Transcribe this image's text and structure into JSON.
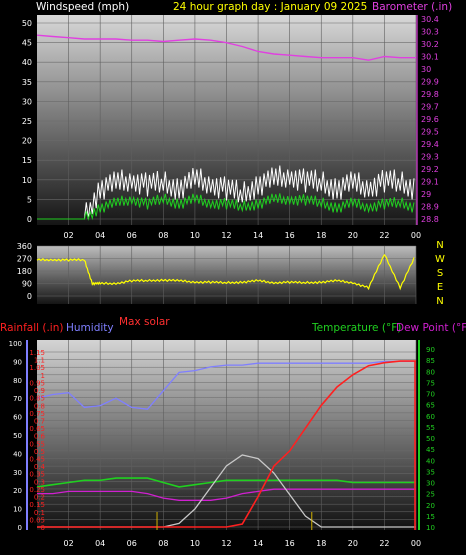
{
  "header": {
    "wind_label": "Windspeed (mph)",
    "title": "24 hour graph day : January 09 2025",
    "baro_label": "Barometer (.in)"
  },
  "labels": {
    "max_solar": "Max solar",
    "rainfall": "Rainfall (.in)",
    "humidity": "Humidity",
    "temperature": "Temperature (°F)",
    "dew_point": "Dew Point (°F)"
  },
  "colors": {
    "wind_text": "#ffffff",
    "title_text": "#ffff00",
    "baro": "#e040e0",
    "wind_avg": "#20d020",
    "wind_gust": "#ffffff",
    "direction": "#ffff00",
    "rain": "#ff2020",
    "humidity": "#7f7fff",
    "temperature": "#20d020",
    "dewpoint": "#d020d0",
    "solar": "#c8c8c8"
  },
  "x_ticks": [
    "02",
    "04",
    "06",
    "08",
    "10",
    "12",
    "14",
    "16",
    "18",
    "20",
    "22",
    "00"
  ],
  "chart_data": [
    {
      "type": "line",
      "title": "24 hour graph day : January 09 2025",
      "ylabel_left": "Windspeed (mph)",
      "ylabel_right": "Barometer (.in)",
      "ylim_left": [
        0,
        50
      ],
      "ylim_right": [
        28.8,
        30.4
      ],
      "y_ticks_left": [
        "0",
        "5",
        "10",
        "15",
        "20",
        "25",
        "30",
        "35",
        "40",
        "45",
        "50"
      ],
      "y_ticks_right": [
        "28.8",
        "28.9",
        "29",
        "29.1",
        "29.2",
        "29.3",
        "29.4",
        "29.5",
        "29.6",
        "29.7",
        "29.8",
        "29.9",
        "30",
        "30.1",
        "30.2",
        "30.3",
        "30.4"
      ],
      "x": [
        0,
        1,
        2,
        3,
        4,
        5,
        6,
        7,
        8,
        9,
        10,
        11,
        12,
        13,
        14,
        15,
        16,
        17,
        18,
        19,
        20,
        21,
        22,
        23,
        24
      ],
      "series": [
        {
          "name": "Barometer",
          "axis": "right",
          "values": [
            30.27,
            30.26,
            30.25,
            30.24,
            30.24,
            30.24,
            30.23,
            30.23,
            30.22,
            30.23,
            30.24,
            30.23,
            30.21,
            30.18,
            30.14,
            30.12,
            30.11,
            30.1,
            30.09,
            30.09,
            30.09,
            30.07,
            30.1,
            30.09,
            30.09
          ]
        },
        {
          "name": "Wind gust",
          "axis": "left",
          "values": [
            0,
            0,
            0,
            0,
            8,
            9,
            10,
            9,
            9,
            8,
            10,
            9,
            8,
            6,
            9,
            10,
            11,
            10,
            9,
            8,
            9,
            8,
            10,
            9,
            8
          ]
        },
        {
          "name": "Wind avg",
          "axis": "left",
          "values": [
            0,
            0,
            0,
            0,
            3,
            4,
            5,
            4,
            5,
            4,
            5,
            4,
            4,
            3,
            4,
            5,
            5,
            5,
            4,
            3,
            4,
            3,
            4,
            4,
            3
          ]
        }
      ]
    },
    {
      "type": "line",
      "ylabel_left": "",
      "ylim": [
        0,
        360
      ],
      "y_ticks_left": [
        "0",
        "90",
        "180",
        "270",
        "360"
      ],
      "y_ticks_right": [
        "N",
        "W",
        "S",
        "E",
        "N"
      ],
      "x": [
        0,
        1,
        2,
        3,
        3.5,
        4,
        5,
        6,
        7,
        8,
        9,
        10,
        11,
        12,
        13,
        14,
        15,
        16,
        17,
        18,
        19,
        20,
        21,
        22,
        23,
        24
      ],
      "series": [
        {
          "name": "Wind direction",
          "values": [
            260,
            260,
            260,
            260,
            90,
            90,
            90,
            110,
            110,
            115,
            110,
            100,
            100,
            95,
            100,
            110,
            95,
            100,
            95,
            100,
            110,
            95,
            60,
            300,
            60,
            300
          ]
        }
      ]
    },
    {
      "type": "line",
      "ylabel_left": "Rainfall (.in)",
      "ylabel_right": "Temperature (°F)",
      "ylim_humidity": [
        0,
        100
      ],
      "ylim_rain": [
        0,
        1.2
      ],
      "ylim_temp": [
        10,
        90
      ],
      "y_ticks_humidity": [
        "0",
        "10",
        "20",
        "30",
        "40",
        "50",
        "60",
        "70",
        "80",
        "90",
        "100"
      ],
      "y_ticks_rain": [
        "0",
        "0.05",
        "0.1",
        "0.15",
        "0.2",
        "0.25",
        "0.3",
        "0.35",
        "0.4",
        "0.45",
        "0.5",
        "0.55",
        "0.6",
        "0.65",
        "0.7",
        "0.75",
        "0.8",
        "0.85",
        "0.9",
        "0.95",
        "1",
        "1.05",
        "1.1",
        "1.15"
      ],
      "y_ticks_temp": [
        "10",
        "15",
        "20",
        "25",
        "30",
        "35",
        "40",
        "45",
        "50",
        "55",
        "60",
        "65",
        "70",
        "75",
        "80",
        "85",
        "90"
      ],
      "x": [
        0,
        1,
        2,
        3,
        4,
        5,
        6,
        7,
        8,
        9,
        10,
        11,
        12,
        13,
        14,
        15,
        16,
        17,
        18,
        19,
        20,
        21,
        22,
        23,
        24
      ],
      "series": [
        {
          "name": "Humidity",
          "values": [
            70,
            72,
            73,
            65,
            66,
            70,
            65,
            64,
            74,
            84,
            85,
            87,
            88,
            88,
            89,
            89,
            89,
            89,
            89,
            89,
            89,
            89,
            90,
            90,
            90
          ]
        },
        {
          "name": "Temperature",
          "values": [
            28,
            29,
            30,
            31,
            31,
            32,
            32,
            32,
            30,
            28,
            29,
            30,
            31,
            31,
            31,
            31,
            31,
            31,
            31,
            31,
            30,
            30,
            30,
            30,
            30
          ]
        },
        {
          "name": "Dew Point",
          "values": [
            25,
            25,
            26,
            26,
            26,
            26,
            26,
            25,
            23,
            22,
            22,
            22,
            23,
            25,
            26,
            27,
            27,
            27,
            27,
            27,
            27,
            27,
            27,
            27,
            27
          ]
        },
        {
          "name": "Max solar",
          "values": [
            0,
            0,
            0,
            0,
            0,
            0,
            0,
            0,
            0,
            0.05,
            0.25,
            0.55,
            0.85,
            1.0,
            0.95,
            0.75,
            0.45,
            0.15,
            0,
            0,
            0,
            0,
            0,
            0,
            0
          ]
        },
        {
          "name": "Rainfall",
          "values": [
            0,
            0,
            0,
            0,
            0,
            0,
            0,
            0,
            0,
            0,
            0,
            0,
            0,
            0.02,
            0.2,
            0.4,
            0.5,
            0.65,
            0.8,
            0.92,
            1.0,
            1.06,
            1.08,
            1.09,
            1.09
          ]
        }
      ]
    }
  ]
}
